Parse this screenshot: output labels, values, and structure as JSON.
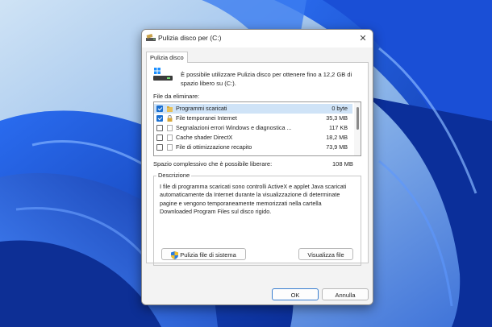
{
  "window": {
    "title": "Pulizia disco per  (C:)",
    "close_label": "✕"
  },
  "tabs": [
    {
      "label": "Pulizia disco"
    }
  ],
  "intro_text": "È possibile utilizzare Pulizia disco per ottenere fino a 12,2 GB di spazio libero su  (C:).",
  "files_label": "File da eliminare:",
  "files": [
    {
      "name": "Programmi scaricati",
      "size": "0 byte",
      "checked": true,
      "selected": true
    },
    {
      "name": "File temporanei Internet",
      "size": "35,3 MB",
      "checked": true,
      "selected": false
    },
    {
      "name": "Segnalazioni errori Windows e diagnostica ...",
      "size": "117 KB",
      "checked": false,
      "selected": false
    },
    {
      "name": "Cache shader DirectX",
      "size": "18,2 MB",
      "checked": false,
      "selected": false
    },
    {
      "name": "File di ottimizzazione recapito",
      "size": "73,9 MB",
      "checked": false,
      "selected": false
    }
  ],
  "total": {
    "label": "Spazio complessivo che è possibile liberare:",
    "value": "108 MB"
  },
  "description": {
    "title": "Descrizione",
    "text": "I file di programma scaricati sono controlli ActiveX e applet Java scaricati automaticamente da Internet durante la visualizzazione di determinate pagine e vengono temporaneamente memorizzati nella cartella Downloaded Program Files sul disco rigido."
  },
  "buttons": {
    "cleanup_system": "Pulizia file di sistema",
    "view_files": "Visualizza file",
    "ok": "OK",
    "cancel": "Annulla"
  },
  "colors": {
    "accent": "#1a6fd0",
    "wallpaper": "#1550d8"
  }
}
